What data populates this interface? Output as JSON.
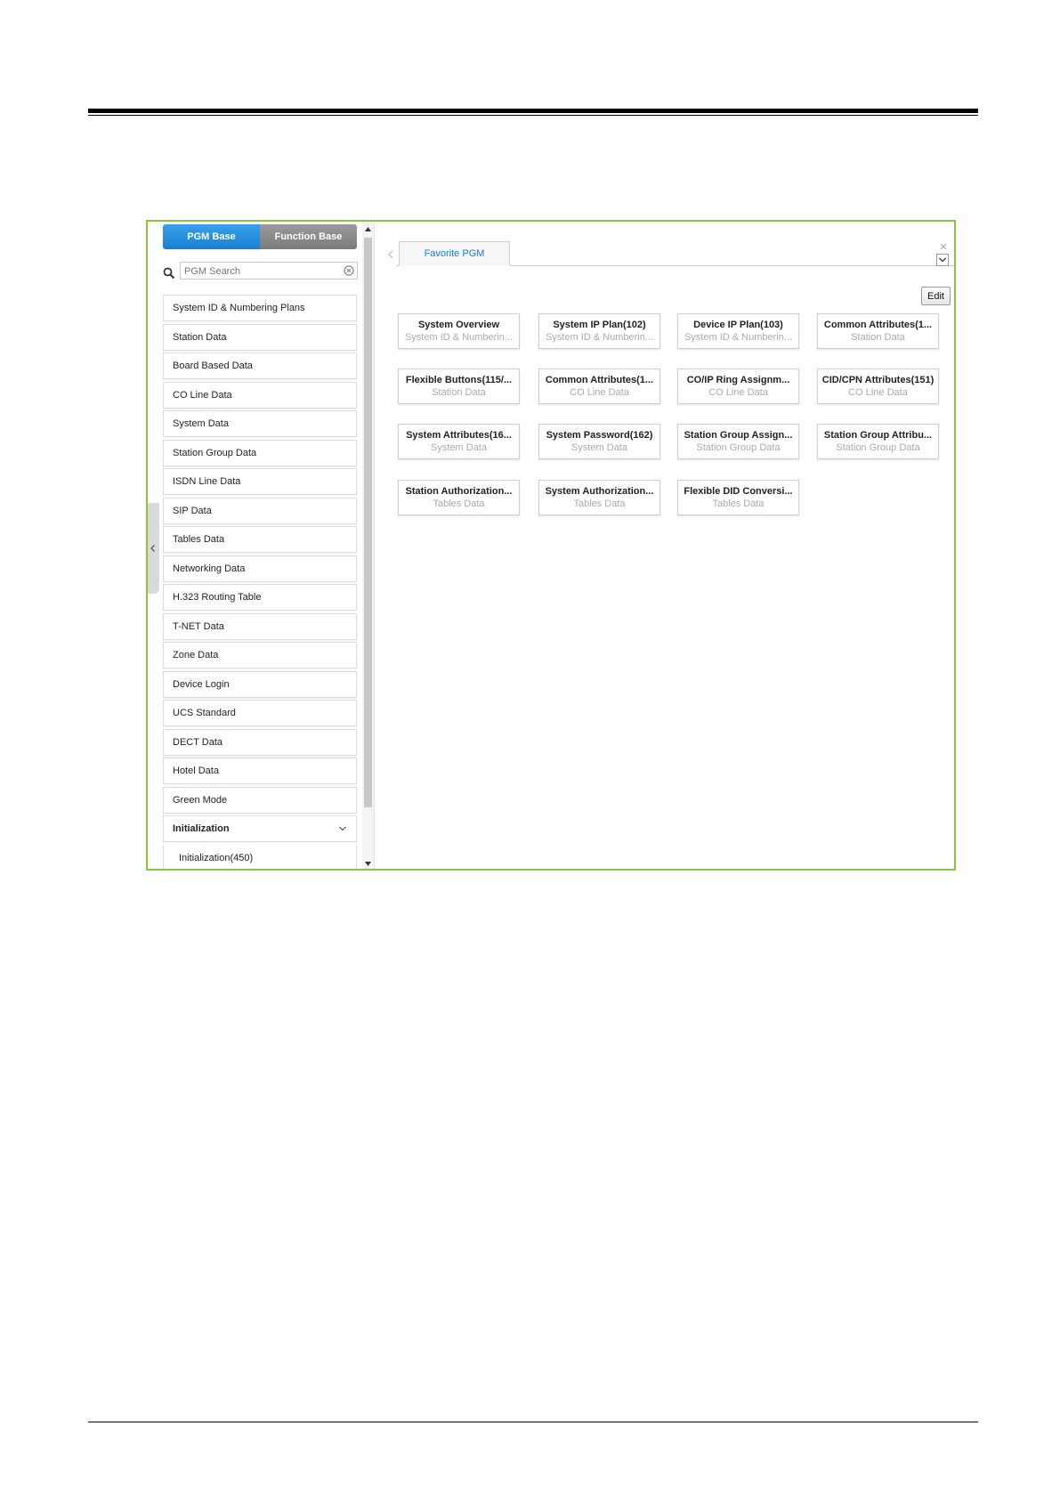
{
  "toggle": {
    "pgm_base": "PGM Base",
    "function_base": "Function Base"
  },
  "search": {
    "placeholder": "PGM Search"
  },
  "sidebar": {
    "items": [
      {
        "label": "System ID & Numbering Plans"
      },
      {
        "label": "Station Data"
      },
      {
        "label": "Board Based Data"
      },
      {
        "label": "CO Line Data"
      },
      {
        "label": "System Data"
      },
      {
        "label": "Station Group Data"
      },
      {
        "label": "ISDN Line Data"
      },
      {
        "label": "SIP Data"
      },
      {
        "label": "Tables Data"
      },
      {
        "label": "Networking Data"
      },
      {
        "label": "H.323 Routing Table"
      },
      {
        "label": "T-NET Data"
      },
      {
        "label": "Zone Data"
      },
      {
        "label": "Device Login"
      },
      {
        "label": "UCS Standard"
      },
      {
        "label": "DECT Data"
      },
      {
        "label": "Hotel Data"
      },
      {
        "label": "Green Mode"
      }
    ],
    "active": {
      "label": "Initialization",
      "sub_items": [
        {
          "label": "Initialization(450)"
        }
      ]
    }
  },
  "tabs": [
    {
      "label": "Favorite PGM"
    }
  ],
  "edit_label": "Edit",
  "cards": [
    {
      "title": "System Overview",
      "subtitle": "System ID & Numberin..."
    },
    {
      "title": "System IP Plan(102)",
      "subtitle": "System ID & Numberin..."
    },
    {
      "title": "Device IP Plan(103)",
      "subtitle": "System ID & Numberin..."
    },
    {
      "title": "Common Attributes(1...",
      "subtitle": "Station Data"
    },
    {
      "title": "Flexible Buttons(115/...",
      "subtitle": "Station Data"
    },
    {
      "title": "Common Attributes(1...",
      "subtitle": "CO Line Data"
    },
    {
      "title": "CO/IP Ring Assignm...",
      "subtitle": "CO Line Data"
    },
    {
      "title": "CID/CPN Attributes(151)",
      "subtitle": "CO Line Data"
    },
    {
      "title": "System Attributes(16...",
      "subtitle": "System Data"
    },
    {
      "title": "System Password(162)",
      "subtitle": "System Data"
    },
    {
      "title": "Station Group Assign...",
      "subtitle": "Station Group Data"
    },
    {
      "title": "Station Group Attribu...",
      "subtitle": "Station Group Data"
    },
    {
      "title": "Station Authorization...",
      "subtitle": "Tables Data"
    },
    {
      "title": "System Authorization...",
      "subtitle": "Tables Data"
    },
    {
      "title": "Flexible DID Conversi...",
      "subtitle": "Tables Data"
    }
  ],
  "colors": {
    "frame_border": "#8cc63f",
    "accent_blue": "#1680d6",
    "tab_text": "#1a7bd0"
  },
  "icons": {
    "search": "search-icon",
    "clear": "clear-icon",
    "collapse": "chevron-left-icon",
    "close": "close-icon",
    "menu": "chevron-down-icon"
  }
}
